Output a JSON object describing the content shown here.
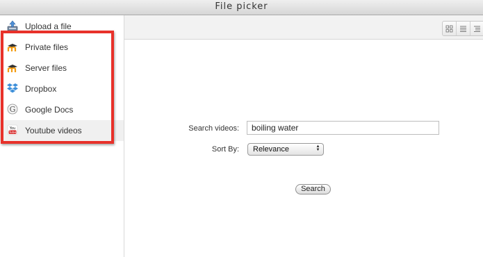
{
  "window": {
    "title": "File picker"
  },
  "sidebar": {
    "items": [
      {
        "label": "Upload a file",
        "icon": "upload-icon"
      },
      {
        "label": "Private files",
        "icon": "moodle-icon"
      },
      {
        "label": "Server files",
        "icon": "moodle-icon"
      },
      {
        "label": "Dropbox",
        "icon": "dropbox-icon"
      },
      {
        "label": "Google Docs",
        "icon": "google-icon"
      },
      {
        "label": "Youtube videos",
        "icon": "youtube-icon",
        "active": true
      }
    ]
  },
  "toolbar": {
    "view_buttons": [
      "grid-view-icon",
      "list-view-icon",
      "tree-view-icon"
    ]
  },
  "form": {
    "search_label": "Search videos:",
    "search_value": "boiling water",
    "sort_label": "Sort By:",
    "sort_value": "Relevance",
    "search_button": "Search"
  },
  "colors": {
    "highlight": "#e8312a",
    "active_item_bg": "#f0f0f0"
  }
}
